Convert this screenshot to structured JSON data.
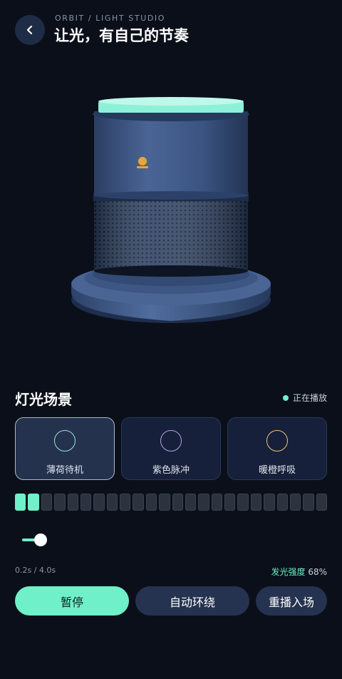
{
  "header": {
    "eyebrow": "ORBIT / LIGHT STUDIO",
    "title": "让光，有自己的节奏"
  },
  "scenes": {
    "title": "灯光场景",
    "status": "正在播放",
    "items": [
      {
        "label": "薄荷待机",
        "ring_color": "#9be7d0",
        "active": true
      },
      {
        "label": "紫色脉冲",
        "ring_color": "#b7a3e6",
        "active": false
      },
      {
        "label": "暖橙呼吸",
        "ring_color": "#f0c27a",
        "active": false
      }
    ]
  },
  "timeline": {
    "total_ticks": 24,
    "active_ticks": 2
  },
  "playback": {
    "time": "0.2s / 4.0s",
    "intensity_label": "发光强度",
    "intensity_value": "68%"
  },
  "buttons": {
    "pause": "暂停",
    "auto_orbit": "自动环绕",
    "replay": "重播入场"
  },
  "colors": {
    "accent": "#6ff0c8",
    "background": "#0a0f1a",
    "device_body": "#3a5482"
  }
}
